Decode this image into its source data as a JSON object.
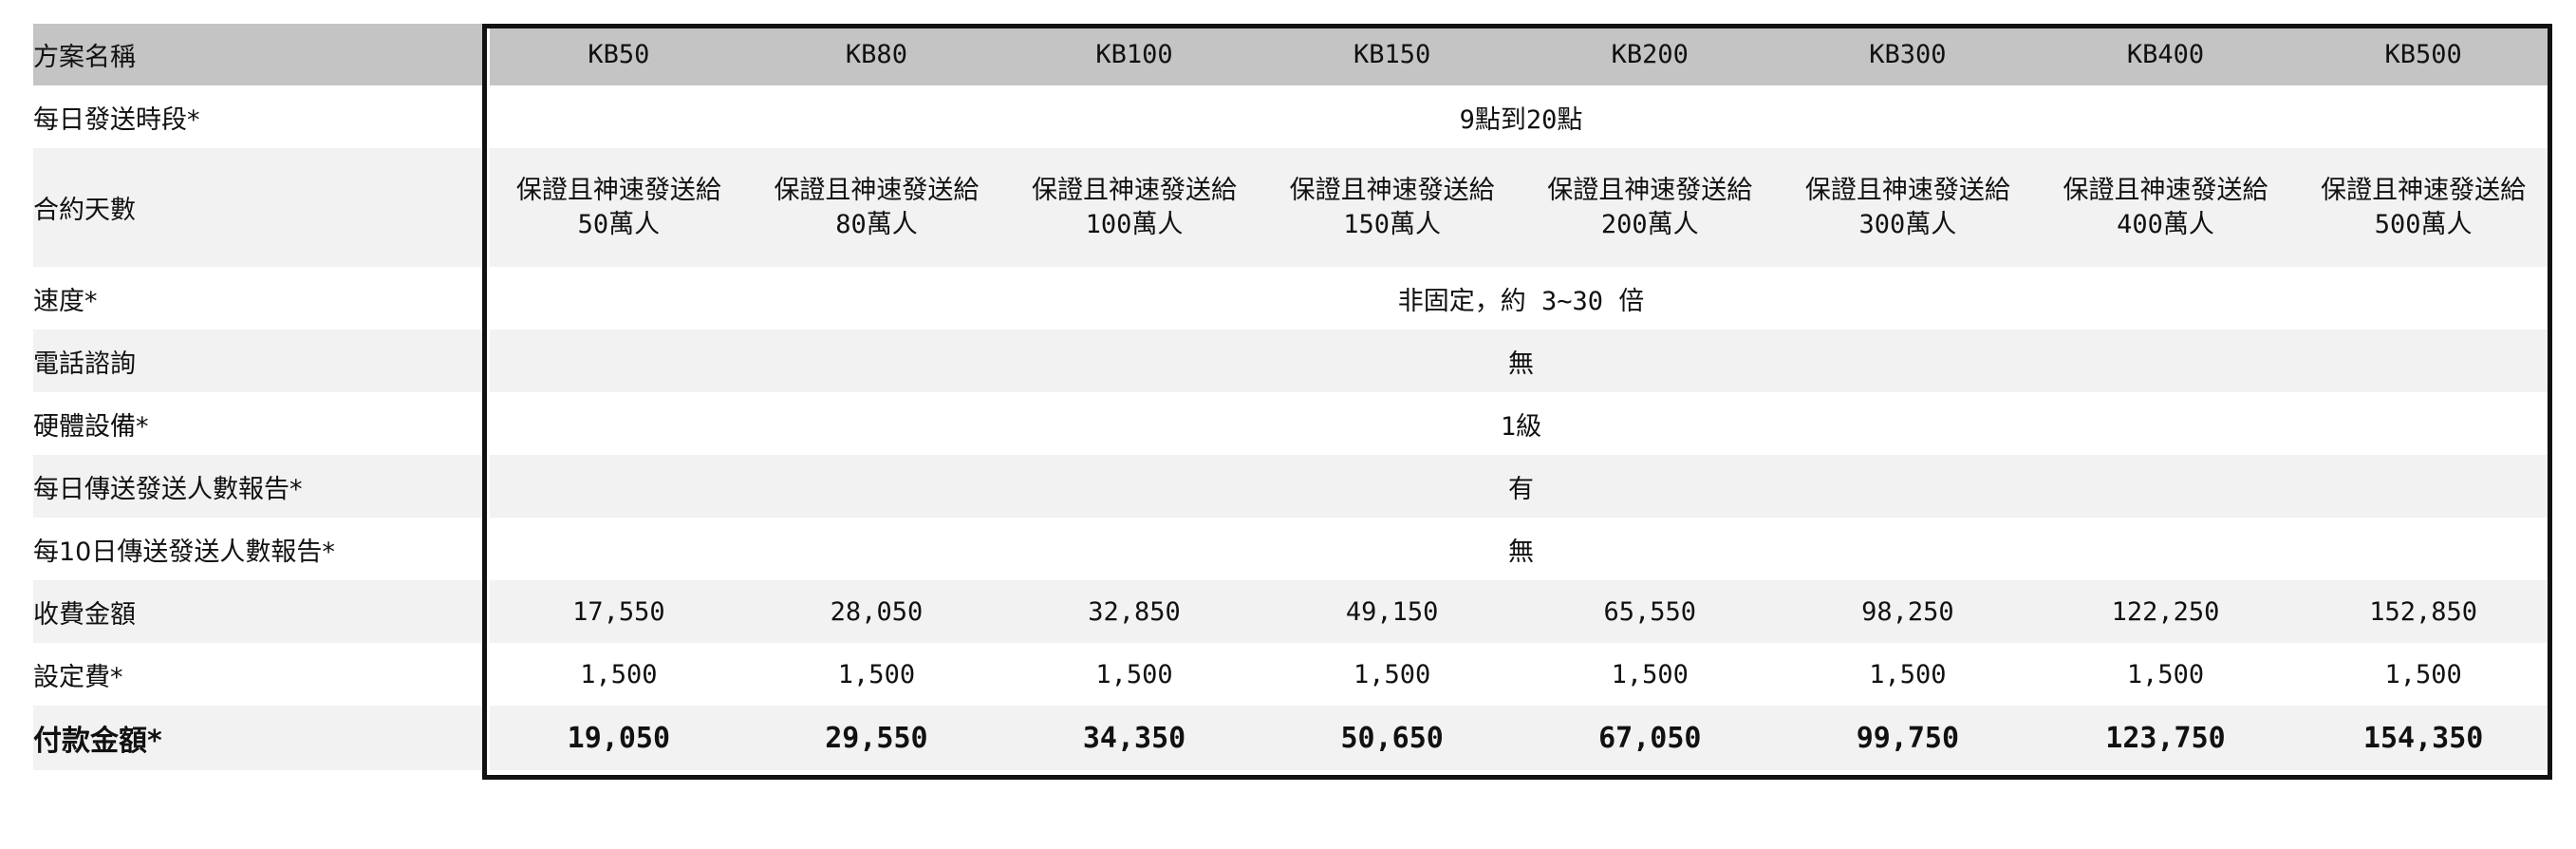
{
  "table": {
    "header_label": "方案名稱",
    "plans": [
      "KB50",
      "KB80",
      "KB100",
      "KB150",
      "KB200",
      "KB300",
      "KB400",
      "KB500"
    ],
    "rows": {
      "daily_time": {
        "label": "每日發送時段*",
        "value": "9點到20點"
      },
      "contract_days": {
        "label": "合約天數",
        "line1": "保證且神速發送給",
        "values": [
          "50萬人",
          "80萬人",
          "100萬人",
          "150萬人",
          "200萬人",
          "300萬人",
          "400萬人",
          "500萬人"
        ]
      },
      "speed": {
        "label": "速度*",
        "value": "非固定，約 3~30 倍"
      },
      "phone": {
        "label": "電話諮詢",
        "value": "無"
      },
      "hardware": {
        "label": "硬體設備*",
        "value": "1級"
      },
      "daily_report": {
        "label": "每日傳送發送人數報告*",
        "value": "有"
      },
      "ten_day_report": {
        "label": "每10日傳送發送人數報告*",
        "value": "無"
      },
      "fee": {
        "label": "收費金額",
        "values": [
          "17,550",
          "28,050",
          "32,850",
          "49,150",
          "65,550",
          "98,250",
          "122,250",
          "152,850"
        ]
      },
      "setup": {
        "label": "設定費*",
        "values": [
          "1,500",
          "1,500",
          "1,500",
          "1,500",
          "1,500",
          "1,500",
          "1,500",
          "1,500"
        ]
      },
      "total": {
        "label": "付款金額*",
        "values": [
          "19,050",
          "29,550",
          "34,350",
          "50,650",
          "67,050",
          "99,750",
          "123,750",
          "154,350"
        ]
      }
    }
  }
}
